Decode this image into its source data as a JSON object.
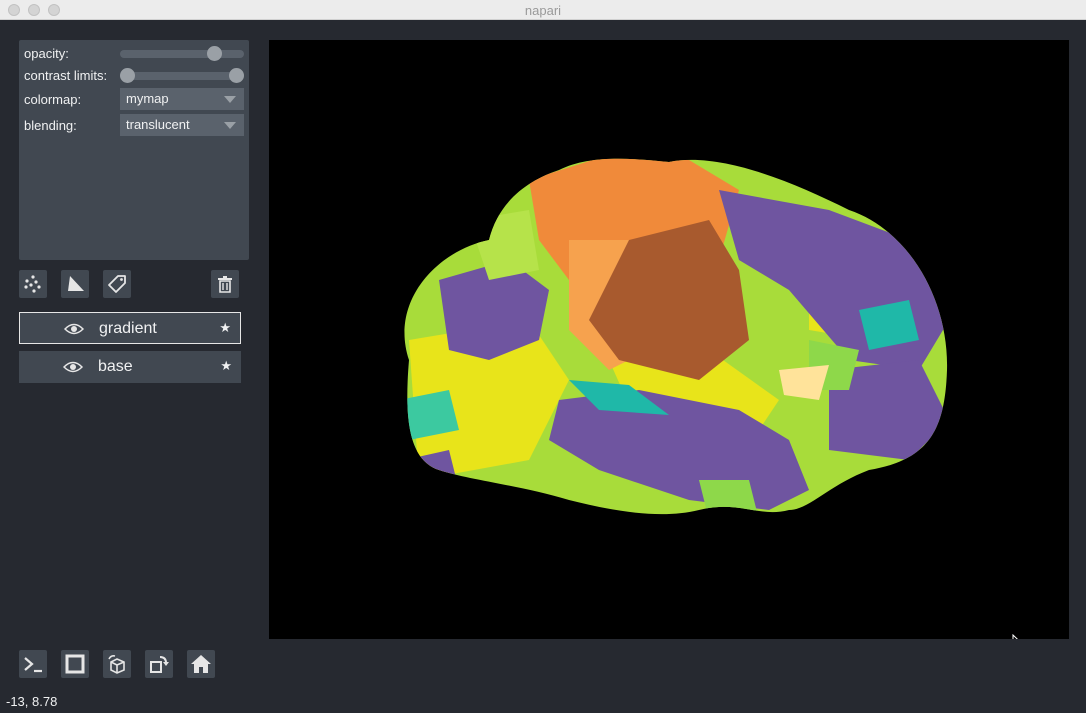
{
  "window": {
    "title": "napari"
  },
  "layer_controls": {
    "opacity_label": "opacity:",
    "opacity_value": 0.8,
    "contrast_label": "contrast limits:",
    "contrast_range": [
      0,
      1
    ],
    "colormap_label": "colormap:",
    "colormap_value": "mymap",
    "blending_label": "blending:",
    "blending_value": "translucent"
  },
  "layer_buttons": {
    "icons": [
      "new-points-icon",
      "new-shapes-icon",
      "new-labels-icon",
      "delete-layer-icon"
    ]
  },
  "layers": [
    {
      "name": "gradient",
      "visible": true,
      "selected": true
    },
    {
      "name": "base",
      "visible": true,
      "selected": false
    }
  ],
  "viewer_buttons": {
    "icons": [
      "console-icon",
      "ndisplay-icon",
      "roll-dims-icon",
      "transpose-icon",
      "home-icon"
    ]
  },
  "status": {
    "coordinates": "-13, 8.78"
  },
  "colors": {
    "background": "#262930",
    "panel": "#414851",
    "purple": "#6f55a0",
    "yellow": "#e8e41a",
    "orange": "#f08a3a",
    "brown": "#a85a2e",
    "teal": "#1fb8a8",
    "green": "#8ed84a"
  }
}
